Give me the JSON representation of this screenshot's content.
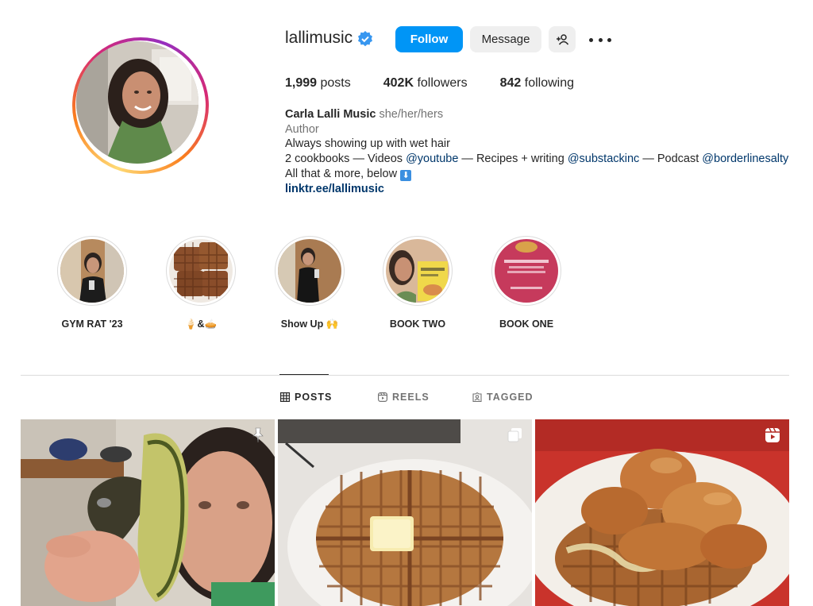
{
  "profile": {
    "username": "lallimusic",
    "follow_label": "Follow",
    "message_label": "Message",
    "stats": {
      "posts_count": "1,999",
      "posts_label": "posts",
      "followers_count": "402K",
      "followers_label": "followers",
      "following_count": "842",
      "following_label": "following"
    },
    "bio": {
      "name": "Carla Lalli Music",
      "pronouns": "she/her/hers",
      "category": "Author",
      "line1": "Always showing up with wet hair",
      "line2_a": "2 cookbooks — Videos ",
      "tag_youtube": "@youtube",
      "line2_b": " — Recipes + writing ",
      "tag_substack": "@substackinc",
      "line2_c": " — Podcast ",
      "tag_borderline": "@borderlinesalty",
      "line3": "All that & more, below",
      "link": "linktr.ee/lallimusic"
    }
  },
  "highlights": [
    {
      "label": "GYM RAT '23"
    },
    {
      "label": "🍦&🥧"
    },
    {
      "label": "Show Up 🙌"
    },
    {
      "label": "BOOK TWO"
    },
    {
      "label": "BOOK ONE"
    }
  ],
  "tabs": [
    {
      "label": "POSTS",
      "icon": "grid-icon",
      "active": true
    },
    {
      "label": "REELS",
      "icon": "reels-icon",
      "active": false
    },
    {
      "label": "TAGGED",
      "icon": "tagged-icon",
      "active": false
    }
  ],
  "posts": [
    {
      "subject": "avocado selfie",
      "badge": "pin-icon"
    },
    {
      "subject": "waffle with butter",
      "badge": "carousel-icon"
    },
    {
      "subject": "chicken and waffles",
      "badge": "reel-icon"
    }
  ],
  "colors": {
    "accent": "#0095f6",
    "link": "#00376b",
    "secondary_text": "#737373",
    "divider": "#dbdbdb"
  }
}
